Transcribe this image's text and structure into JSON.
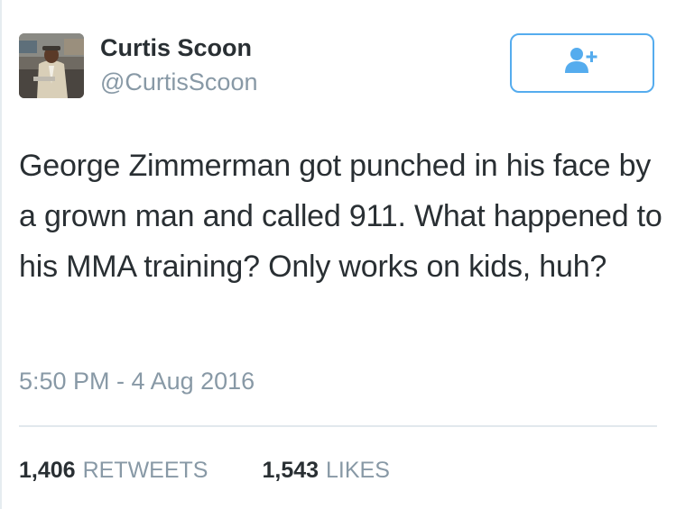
{
  "user": {
    "display_name": "Curtis Scoon",
    "screen_name": "@CurtisScoon"
  },
  "tweet": {
    "text": "George Zimmerman got punched in his face by a grown man and called 911. What happened to his MMA training? Only works on kids, huh?",
    "timestamp": "5:50 PM - 4 Aug 2016"
  },
  "stats": {
    "retweets_count": "1,406",
    "retweets_label": "RETWEETS",
    "likes_count": "1,543",
    "likes_label": "LIKES"
  },
  "icons": {
    "follow": "add-user-icon"
  },
  "colors": {
    "accent": "#55acee",
    "text": "#292f33",
    "muted": "#8899a6",
    "divider": "#e1e8ed"
  }
}
